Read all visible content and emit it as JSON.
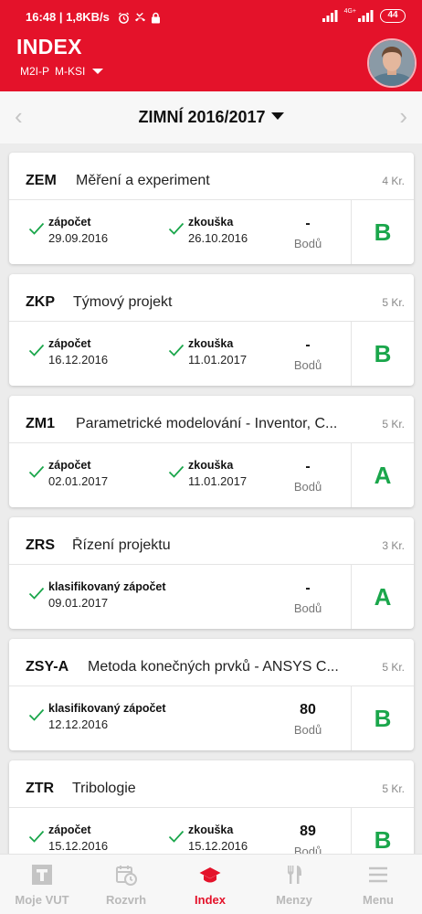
{
  "status_bar": {
    "time": "16:48",
    "speed": "1,8KB/s",
    "network": "4G+",
    "battery": "44"
  },
  "header": {
    "title": "INDEX",
    "program": "M2I-P",
    "field": "M-KSI"
  },
  "semester": {
    "label": "ZIMNÍ 2016/2017",
    "prev": "‹",
    "next": "›"
  },
  "colors": {
    "brand": "#e4122a",
    "grade": "#1aa64b",
    "check": "#1aa64b"
  },
  "courses": [
    {
      "code": "ZEM",
      "name": "Měření a experiment",
      "credits": "4 Kr.",
      "items": [
        {
          "label": "zápočet",
          "date": "29.09.2016"
        },
        {
          "label": "zkouška",
          "date": "26.10.2016"
        }
      ],
      "points": "-",
      "points_label": "Bodů",
      "grade": "B"
    },
    {
      "code": "ZKP",
      "name": "Týmový projekt",
      "credits": "5 Kr.",
      "items": [
        {
          "label": "zápočet",
          "date": "16.12.2016"
        },
        {
          "label": "zkouška",
          "date": "11.01.2017"
        }
      ],
      "points": "-",
      "points_label": "Bodů",
      "grade": "B"
    },
    {
      "code": "ZM1",
      "name": "Parametrické modelování - Inventor, C...",
      "credits": "5 Kr.",
      "items": [
        {
          "label": "zápočet",
          "date": "02.01.2017"
        },
        {
          "label": "zkouška",
          "date": "11.01.2017"
        }
      ],
      "points": "-",
      "points_label": "Bodů",
      "grade": "A"
    },
    {
      "code": "ZRS",
      "name": "Řízení projektu",
      "credits": "3 Kr.",
      "items": [
        {
          "label": "klasifikovaný zápočet",
          "date": "09.01.2017"
        }
      ],
      "points": "-",
      "points_label": "Bodů",
      "grade": "A"
    },
    {
      "code": "ZSY-A",
      "name": "Metoda konečných prvků - ANSYS C...",
      "credits": "5 Kr.",
      "items": [
        {
          "label": "klasifikovaný zápočet",
          "date": "12.12.2016"
        }
      ],
      "points": "80",
      "points_label": "Bodů",
      "grade": "B"
    },
    {
      "code": "ZTR",
      "name": "Tribologie",
      "credits": "5 Kr.",
      "items": [
        {
          "label": "zápočet",
          "date": "15.12.2016"
        },
        {
          "label": "zkouška",
          "date": "15.12.2016"
        }
      ],
      "points": "89",
      "points_label": "Bodů",
      "grade": "B"
    }
  ],
  "bottom_nav": [
    {
      "label": "Moje VUT",
      "icon": "vut-logo-icon",
      "active": false
    },
    {
      "label": "Rozvrh",
      "icon": "calendar-clock-icon",
      "active": false
    },
    {
      "label": "Index",
      "icon": "graduation-cap-icon",
      "active": true
    },
    {
      "label": "Menzy",
      "icon": "fork-knife-icon",
      "active": false
    },
    {
      "label": "Menu",
      "icon": "hamburger-menu-icon",
      "active": false
    }
  ]
}
